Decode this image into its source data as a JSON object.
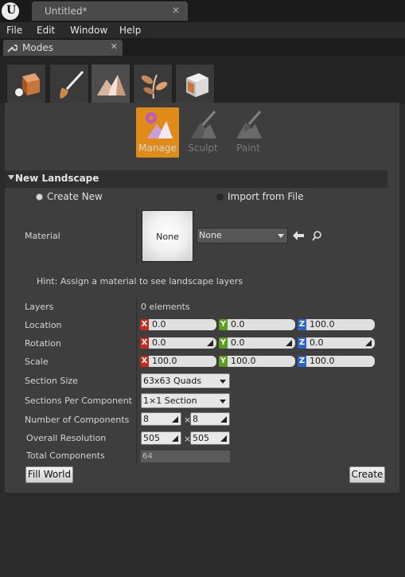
{
  "window": {
    "doc_tab_title": "Untitled*",
    "close_glyph": "✕"
  },
  "menu": [
    "File",
    "Edit",
    "Window",
    "Help"
  ],
  "panel_tab": {
    "label": "Modes",
    "icon": "wrench-icon",
    "close_glyph": "✕"
  },
  "mode_icons": [
    "place-mode-icon",
    "paint-mode-icon",
    "landscape-mode-icon",
    "foliage-mode-icon",
    "geometry-mode-icon"
  ],
  "tools": [
    {
      "label": "Manage",
      "active": true
    },
    {
      "label": "Sculpt",
      "active": false
    },
    {
      "label": "Paint",
      "active": false
    }
  ],
  "new_landscape": {
    "header": "New Landscape",
    "create_new": "Create New",
    "import_from_file": "Import from File",
    "selected_option": "Create New",
    "material": {
      "label": "Material",
      "thumbnail_text": "None",
      "combo_value": "None"
    },
    "hint": "Hint: Assign a material to see landscape layers",
    "layers": {
      "label": "Layers",
      "value": "0 elements"
    },
    "location": {
      "label": "Location",
      "x": "0.0",
      "y": "0.0",
      "z": "100.0"
    },
    "rotation": {
      "label": "Rotation",
      "x": "0.0",
      "y": "0.0",
      "z": "0.0"
    },
    "scale": {
      "label": "Scale",
      "x": "100.0",
      "y": "100.0",
      "z": "100.0"
    },
    "axis_letters": {
      "x": "X",
      "y": "Y",
      "z": "Z"
    },
    "section_size": {
      "label": "Section Size",
      "value": "63x63 Quads"
    },
    "sections_per_component": {
      "label": "Sections Per Component",
      "value": "1×1 Section"
    },
    "number_of_components": {
      "label": "Number of Components",
      "x": "8",
      "y": "8"
    },
    "overall_resolution": {
      "label": "Overall Resolution",
      "x": "505",
      "y": "505"
    },
    "total_components": {
      "label": "Total Components",
      "value": "64"
    },
    "times_glyph": "×",
    "fill_world_button": "Fill World",
    "create_button": "Create"
  },
  "colors": {
    "accent_orange": "#e08a18",
    "axis_x": "#c52b1a",
    "axis_y": "#5a9e1a",
    "axis_z": "#2a64c8"
  }
}
